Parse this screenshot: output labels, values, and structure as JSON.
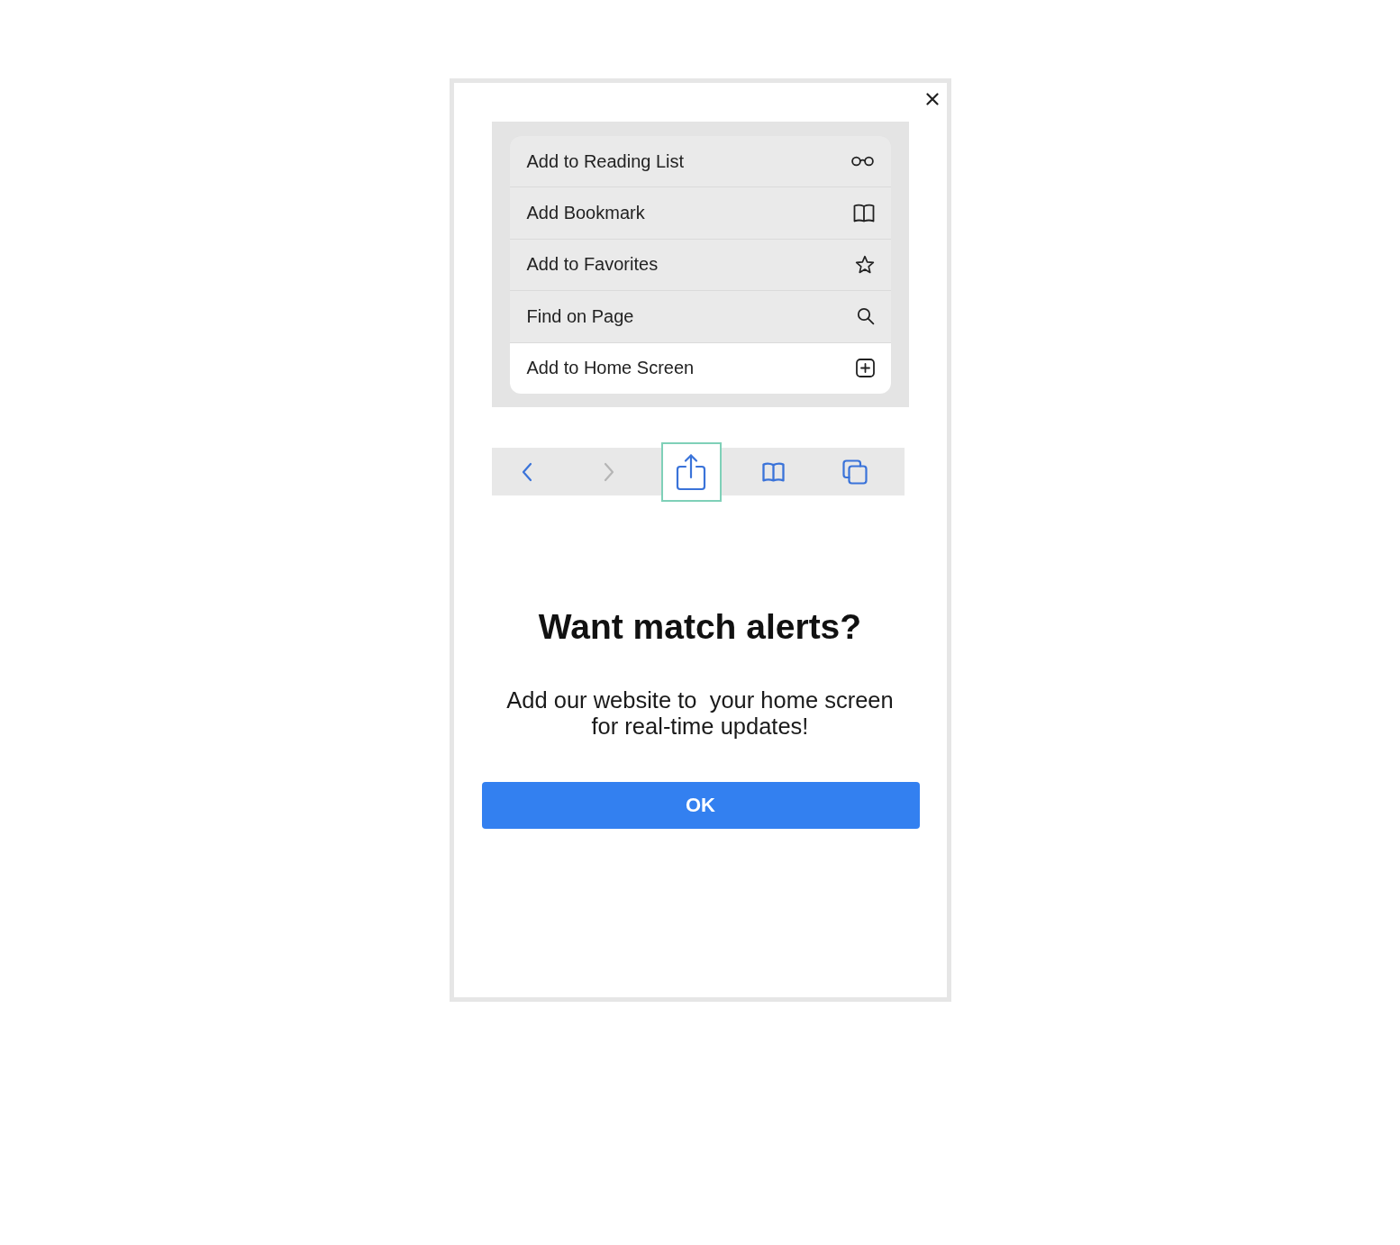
{
  "illustration": {
    "menu_items": [
      {
        "label": "Add to Reading List",
        "kind": "glasses",
        "selected": false
      },
      {
        "label": "Add Bookmark",
        "kind": "book",
        "selected": false
      },
      {
        "label": "Add to Favorites",
        "kind": "star",
        "selected": false
      },
      {
        "label": "Find on Page",
        "kind": "search",
        "selected": false
      },
      {
        "label": "Add to Home Screen",
        "kind": "add",
        "selected": true
      }
    ],
    "toolbar": [
      {
        "kind": "back",
        "disabled": false,
        "selected": false
      },
      {
        "kind": "forward",
        "disabled": true,
        "selected": false
      },
      {
        "kind": "share",
        "disabled": false,
        "selected": true
      },
      {
        "kind": "bookmarks",
        "disabled": false,
        "selected": false
      },
      {
        "kind": "tabs",
        "disabled": false,
        "selected": false
      }
    ]
  },
  "title": "Want match alerts?",
  "message": "Add our website to  your home screen for real-time updates!",
  "ok_button": {
    "label": "OK"
  }
}
